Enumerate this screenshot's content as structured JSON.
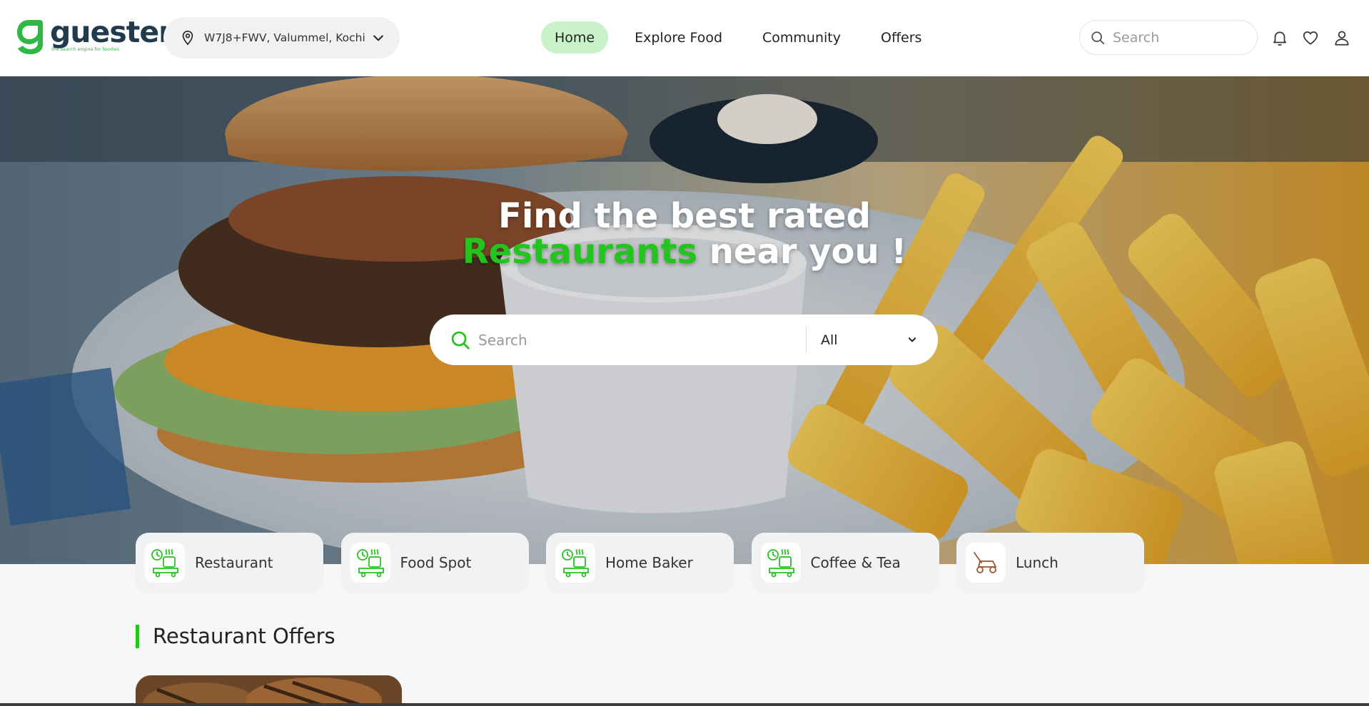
{
  "brand": {
    "name": "guester",
    "tagline": "the search engine for foodies",
    "color_primary": "#24c41f",
    "color_dark": "#1f3b4d"
  },
  "location": {
    "icon": "location-pin-icon",
    "text": "W7J8+FWV, Valummel, Kochi"
  },
  "nav": {
    "items": [
      {
        "label": "Home",
        "active": true
      },
      {
        "label": "Explore Food",
        "active": false
      },
      {
        "label": "Community",
        "active": false
      },
      {
        "label": "Offers",
        "active": false
      }
    ]
  },
  "header_search": {
    "placeholder": "Search"
  },
  "header_icons": [
    "bell-icon",
    "heart-icon",
    "user-icon"
  ],
  "hero": {
    "title_line1": "Find the best rated",
    "title_accent": "Restaurants",
    "title_rest": " near you !",
    "search_placeholder": "Search",
    "filter_value": "All"
  },
  "categories": [
    {
      "label": "Restaurant",
      "icon": "restaurant-delivery-icon"
    },
    {
      "label": "Food Spot",
      "icon": "food-spot-delivery-icon"
    },
    {
      "label": "Home Baker",
      "icon": "home-baker-delivery-icon"
    },
    {
      "label": "Coffee & Tea",
      "icon": "coffee-tea-delivery-icon"
    },
    {
      "label": "Lunch",
      "icon": "lawn-mower-icon"
    }
  ],
  "offers_section": {
    "title": "Restaurant Offers"
  }
}
